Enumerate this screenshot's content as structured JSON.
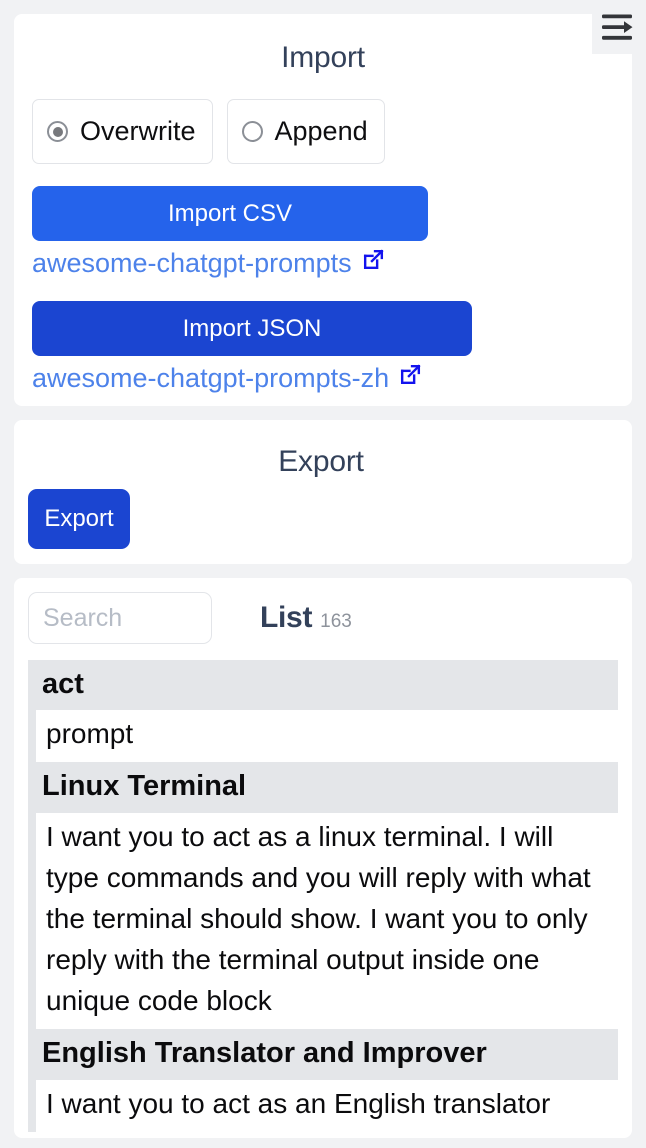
{
  "topbar": {
    "sidebar_toggle_icon": "menu-arrow-right-icon"
  },
  "import": {
    "title": "Import",
    "mode_options": [
      {
        "label": "Overwrite",
        "selected": true
      },
      {
        "label": "Append",
        "selected": false
      }
    ],
    "csv_button_label": "Import CSV",
    "csv_link_label": "awesome-chatgpt-prompts",
    "json_button_label": "Import JSON",
    "json_link_label": "awesome-chatgpt-prompts-zh",
    "external_link_icon": "external-link-icon"
  },
  "export": {
    "title": "Export",
    "button_label": "Export"
  },
  "list": {
    "title": "List",
    "count": "163",
    "search_placeholder": "Search",
    "search_value": "",
    "columns": {
      "act": "act",
      "prompt": "prompt"
    },
    "rows": [
      {
        "act": "Linux Terminal",
        "prompt": "I want you to act as a linux terminal. I will type commands and you will reply with what the terminal should show. I want you to only reply with the terminal output inside one unique code block"
      },
      {
        "act": "English Translator and Improver",
        "prompt": "I want you to act as an English translator"
      }
    ]
  },
  "colors": {
    "page_background": "#f1f2f4",
    "card_background": "#ffffff",
    "title": "#33415a",
    "primary_button": "#2563eb",
    "primary_button_dark": "#1b45d1",
    "link": "#4d82ea",
    "external_icon": "#1313ee",
    "row_header_background": "#e4e6e9"
  }
}
